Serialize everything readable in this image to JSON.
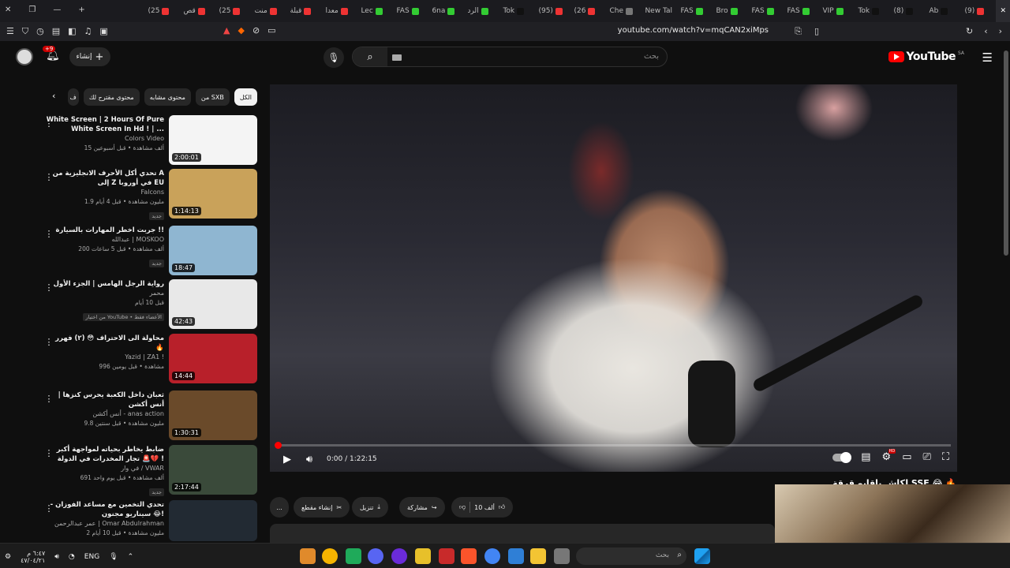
{
  "browser": {
    "tabs": [
      {
        "label": "(9)",
        "color": "#e33"
      },
      {
        "label": "Ab",
        "color": "#111"
      },
      {
        "label": "(8)",
        "color": "#111"
      },
      {
        "label": "Tok",
        "color": "#111"
      },
      {
        "label": "VIP",
        "color": "#3c3"
      },
      {
        "label": "FAS",
        "color": "#3c3"
      },
      {
        "label": "FAS",
        "color": "#3c3"
      },
      {
        "label": "Bro",
        "color": "#3c3"
      },
      {
        "label": "FAS",
        "color": "#3c3"
      },
      {
        "label": "New Tal",
        "color": "#555"
      },
      {
        "label": "Che",
        "color": "#777"
      },
      {
        "label": "(26",
        "color": "#e33"
      },
      {
        "label": "(95)",
        "color": "#e33"
      },
      {
        "label": "Tok",
        "color": "#111"
      },
      {
        "label": "الرد",
        "color": "#3c3"
      },
      {
        "label": "6na",
        "color": "#3c3"
      },
      {
        "label": "FAS",
        "color": "#3c3"
      },
      {
        "label": "Lec",
        "color": "#3c3"
      },
      {
        "label": "معدا",
        "color": "#e33"
      },
      {
        "label": "قبلة",
        "color": "#e33"
      },
      {
        "label": "منت",
        "color": "#e33"
      },
      {
        "label": "(25",
        "color": "#e33"
      },
      {
        "label": "قص",
        "color": "#e33"
      },
      {
        "label": "(25",
        "color": "#e33"
      }
    ],
    "url": "youtube.com/watch?v=mqCAN2xiMps"
  },
  "youtube": {
    "logo_text": "YouTube",
    "region": "SA",
    "search_placeholder": "بحث",
    "create_label": "إنشاء",
    "notifications_badge": "+9",
    "chips": [
      "الكل",
      "من SXB",
      "محتوى مشابه",
      "محتوى مقترح لك",
      "ف"
    ],
    "player": {
      "time": "0:00 / 1:22:15",
      "hd_badge": "HD",
      "progress": 0.0
    },
    "video_title": "لكاش ياقابو قرقة SSF 😂 🔥",
    "actions": {
      "likes": "10 ألف",
      "share": "مشاركة",
      "download": "تنزيل",
      "clip": "إنشاء مقطع",
      "more": "..."
    },
    "recommendations": [
      {
        "title": "White Screen | 2 Hours Of Pure White Screen In Hd ! | ...",
        "channel": "Colors Video",
        "meta": "15 ألف مشاهدة • قبل أسبوعين",
        "badge": "",
        "duration": "2:00:01",
        "thumb_color": "#f4f4f4"
      },
      {
        "title": "تحدي أكل الأحرف الانجليزية من A إلى Z في أوروبا EU",
        "channel": "Falcons",
        "meta": "1.9 مليون مشاهدة • قبل 4 أيام",
        "badge": "جديد",
        "duration": "1:14:13",
        "thumb_color": "#c9a25a"
      },
      {
        "title": "جربت اخطر المهارات بالسيارة !!",
        "channel": "عبدالله | MOSKOO",
        "meta": "200 ألف مشاهدة • قبل 5 ساعات",
        "badge": "جديد",
        "duration": "18:47",
        "thumb_color": "#8fb6d1"
      },
      {
        "title": "رواية الرجل الهامس | الجزء الأول",
        "channel": "محمر",
        "meta": "قبل 10 أيام",
        "badge": "من اختيار YouTube • الأعضاء فقط",
        "duration": "42:43",
        "thumb_color": "#e8e8e8"
      },
      {
        "title": "محاولة الى الاحتراف 😳 (٢) فهرر 🔥",
        "channel": "Yazid | ZA1 !",
        "meta": "996 مشاهدة • قبل يومين",
        "badge": "",
        "duration": "14:44",
        "thumb_color": "#b8202a"
      },
      {
        "title": "ثعبان داخل الكعبة يحرس كنزها | أنس أكشن",
        "channel": "أنس أكشن - anas action",
        "meta": "9.8 مليون مشاهدة • قبل سنتين",
        "badge": "",
        "duration": "1:30:31",
        "thumb_color": "#6a4a2a"
      },
      {
        "title": "ضابط يخاطر بحياته لمواجهة أكبر تجار المخدرات في الدولة 🚨💔 !",
        "channel": "في وار / VWAR",
        "meta": "691 ألف مشاهدة • قبل يوم واحد",
        "badge": "جديد",
        "duration": "2:17:44",
        "thumb_color": "#3a4a3a"
      },
      {
        "title": "تحدي التخمين مع مساعد الفوزان - سيناريو مجنون 😂!",
        "channel": "عمر عبدالرحمن | Omar Abdulrahman",
        "meta": "2 مليون مشاهدة • قبل 10 أيام",
        "badge": "",
        "duration": "",
        "thumb_color": "#222a33"
      }
    ]
  },
  "taskbar": {
    "search_placeholder": "بحث",
    "lang": "ENG",
    "time": "٦:٤٧ م",
    "date": "٤٧/٠٤/٢١"
  }
}
